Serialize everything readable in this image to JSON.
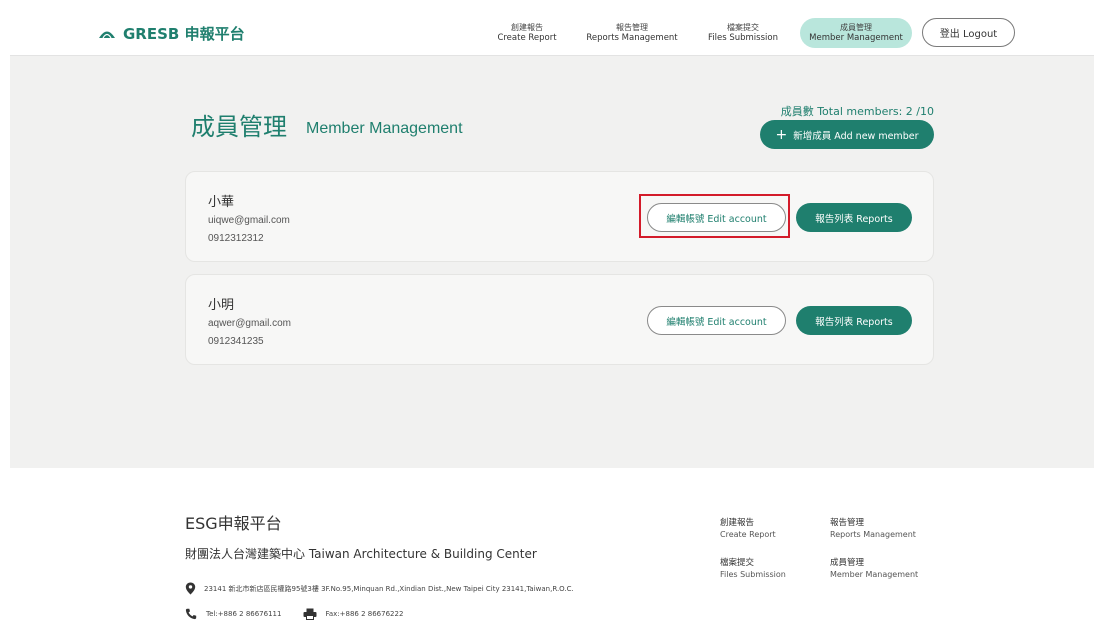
{
  "header": {
    "brand": "GRESB 申報平台",
    "nav": [
      {
        "zh": "創建報告",
        "en": "Create Report"
      },
      {
        "zh": "報告管理",
        "en": "Reports Management"
      },
      {
        "zh": "檔案提交",
        "en": "Files Submission"
      },
      {
        "zh": "成員管理",
        "en": "Member Management"
      }
    ],
    "logout_label": "登出 Logout"
  },
  "page": {
    "title_zh": "成員管理",
    "title_en": "Member Management",
    "member_count": "成員數 Total members: 2 /10",
    "add_member_label": "新增成員 Add new member",
    "add_member_icon": "plus-icon"
  },
  "members": [
    {
      "name": "小華",
      "email": "uiqwe@gmail.com",
      "phone": "0912312312",
      "edit_label": "編輯帳號 Edit account",
      "reports_label": "報告列表 Reports"
    },
    {
      "name": "小明",
      "email": "aqwer@gmail.com",
      "phone": "0912341235",
      "edit_label": "編輯帳號 Edit account",
      "reports_label": "報告列表 Reports"
    }
  ],
  "footer": {
    "title": "ESG申報平台",
    "org": "財團法人台灣建築中心 Taiwan Architecture & Building Center",
    "address": "23141 新北市新店區民權路95號3樓 3F.No.95,Minquan Rd.,Xindian Dist.,New Taipei City 23141,Taiwan,R.O.C.",
    "tel": "Tel:+886 2 86676111",
    "fax": "Fax:+886 2 86676222",
    "links": [
      {
        "zh": "創建報告",
        "en": "Create Report"
      },
      {
        "zh": "報告管理",
        "en": "Reports Management"
      },
      {
        "zh": "檔案提交",
        "en": "Files Submission"
      },
      {
        "zh": "成員管理",
        "en": "Member Management"
      }
    ]
  },
  "colors": {
    "brand": "#1f7f6e",
    "nav_active_bg": "#b9e6dc",
    "highlight": "#d31b2a",
    "page_bg": "#f1f1f0"
  }
}
